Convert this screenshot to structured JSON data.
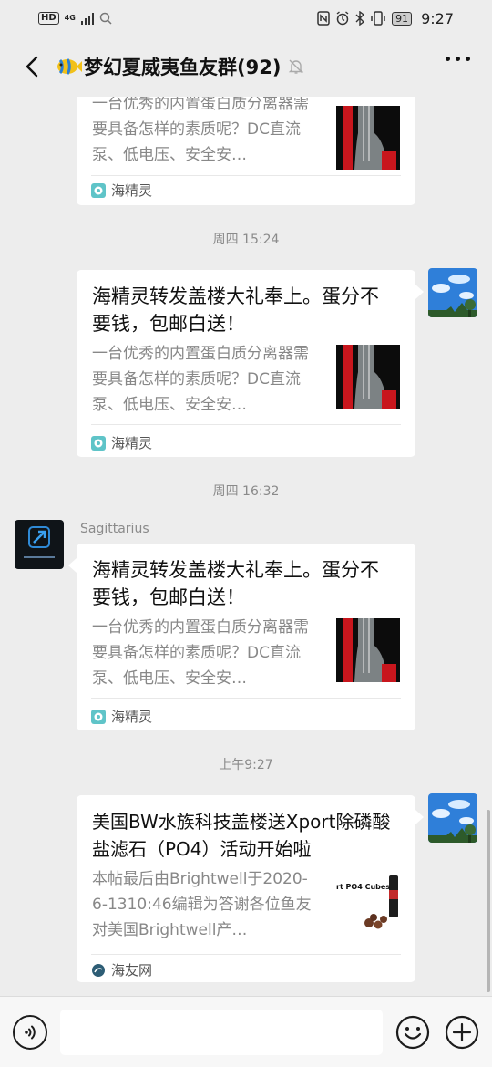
{
  "status_bar": {
    "hd": "HD",
    "network": "4G",
    "battery": "91",
    "time": "9:27"
  },
  "header": {
    "title": "梦幻夏威夷鱼友群(92)",
    "back_icon": "chevron-left-icon",
    "mute_icon": "bell-off-icon",
    "more_icon": "more-dots-icon"
  },
  "messages": [
    {
      "type": "link_card",
      "side": "right",
      "title": "",
      "desc": "一台优秀的内置蛋白质分离器需要具备怎样的素质呢？DC直流泵、低电压、安全安…",
      "source": "海精灵"
    },
    {
      "type": "timestamp",
      "text": "周四 15:24"
    },
    {
      "type": "link_card",
      "side": "right",
      "title": "海精灵转发盖楼大礼奉上。蛋分不要钱，包邮白送！",
      "desc": "一台优秀的内置蛋白质分离器需要具备怎样的素质呢？DC直流泵、低电压、安全安…",
      "source": "海精灵"
    },
    {
      "type": "timestamp",
      "text": "周四 16:32"
    },
    {
      "type": "link_card",
      "side": "left",
      "sender": "Sagittarius",
      "title": "海精灵转发盖楼大礼奉上。蛋分不要钱，包邮白送！",
      "desc": "一台优秀的内置蛋白质分离器需要具备怎样的素质呢？DC直流泵、低电压、安全安…",
      "source": "海精灵"
    },
    {
      "type": "timestamp",
      "text": "上午9:27"
    },
    {
      "type": "link_card",
      "side": "right",
      "title": "美国BW水族科技盖楼送Xport除磷酸盐滤石（PO4）活动开始啦",
      "desc": "本帖最后由Brightwell于2020-6-1310:46编辑为答谢各位鱼友对美国Brightwell产…",
      "thumb_text": "rt PO4 Cubes",
      "source": "海友网"
    }
  ],
  "input_bar": {
    "voice_icon": "voice-icon",
    "emoji_icon": "emoji-icon",
    "plus_icon": "plus-circle-icon"
  }
}
